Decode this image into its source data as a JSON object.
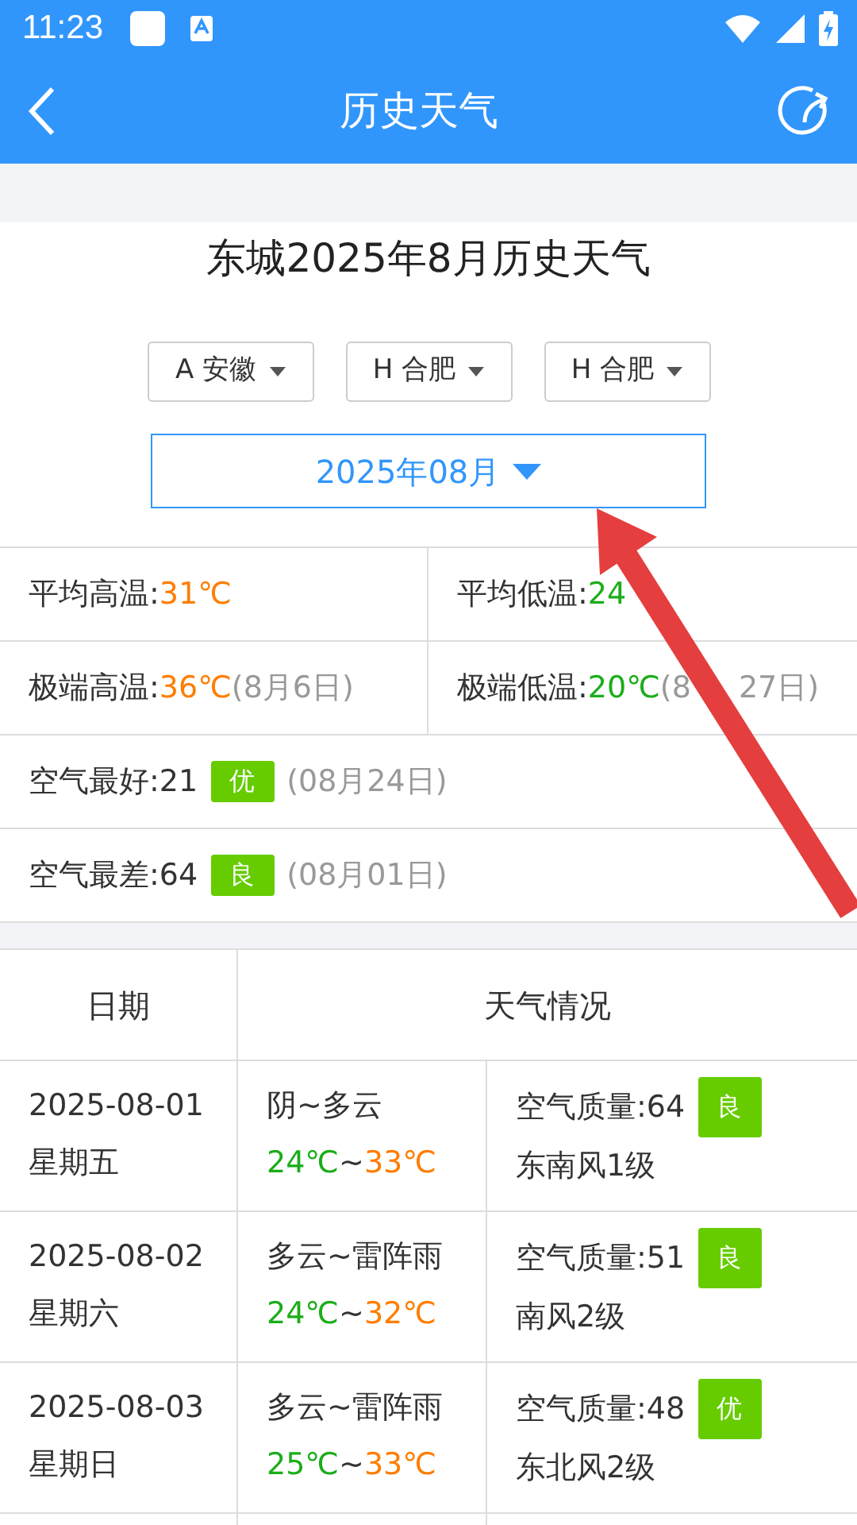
{
  "status_bar": {
    "time": "11:23"
  },
  "header": {
    "title": "历史天气"
  },
  "page_title": "东城2025年8月历史天气",
  "selectors": [
    {
      "label": "A 安徽"
    },
    {
      "label": "H 合肥"
    },
    {
      "label": "H 合肥"
    }
  ],
  "month_picker": {
    "label": "2025年08月"
  },
  "stats": [
    {
      "kind": "high",
      "label": "平均高温:",
      "value": "31℃"
    },
    {
      "kind": "low",
      "label": "平均低温:",
      "value": "24"
    },
    {
      "kind": "high",
      "label": "极端高温:",
      "value": "36℃",
      "date": "(8月6日)"
    },
    {
      "kind": "low",
      "label": "极端低温:",
      "value": "20℃",
      "date": "(8",
      "date_tail": "27日)"
    },
    {
      "kind": "air",
      "label": "空气最好:21",
      "badge": "优",
      "date": "(08月24日)"
    },
    {
      "kind": "air",
      "label": "空气最差:64",
      "badge": "良",
      "date": "(08月01日)"
    }
  ],
  "table": {
    "columns": [
      "日期",
      "天气情况"
    ],
    "rows": [
      {
        "date": "2025-08-01",
        "weekday": "星期五",
        "weather": "阴~多云",
        "low": "24℃",
        "sep": "~",
        "high": "33℃",
        "air": "空气质量:64",
        "badge": "良",
        "wind": "东南风1级"
      },
      {
        "date": "2025-08-02",
        "weekday": "星期六",
        "weather": "多云~雷阵雨",
        "low": "24℃",
        "sep": "~",
        "high": "32℃",
        "air": "空气质量:51",
        "badge": "良",
        "wind": "南风2级"
      },
      {
        "date": "2025-08-03",
        "weekday": "星期日",
        "weather": "多云~雷阵雨",
        "low": "25℃",
        "sep": "~",
        "high": "33℃",
        "air": "空气质量:48",
        "badge": "优",
        "wind": "东北风2级"
      }
    ]
  }
}
